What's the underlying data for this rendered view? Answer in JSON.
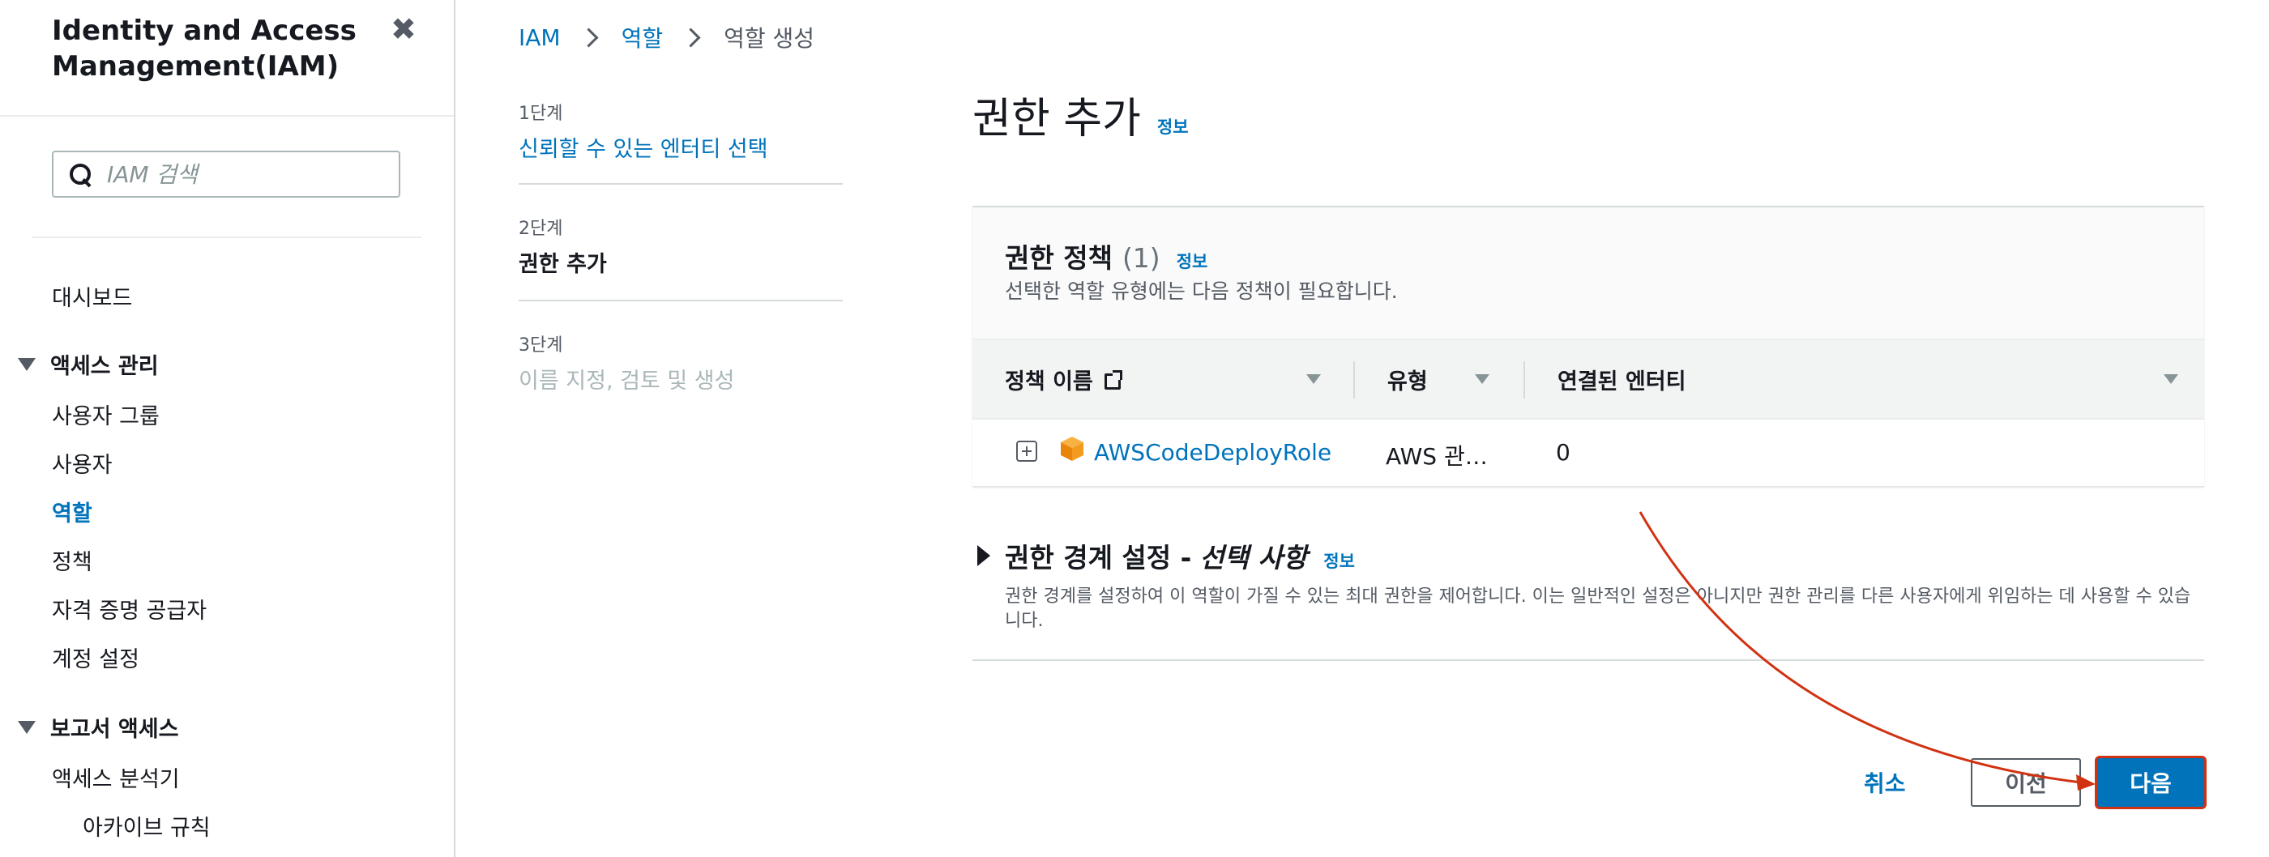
{
  "sidebar": {
    "title": "Identity and Access Management(IAM)",
    "search_placeholder": "IAM 검색",
    "items": {
      "dashboard": "대시보드",
      "access_mgmt": "액세스 관리",
      "user_groups": "사용자 그룹",
      "users": "사용자",
      "roles": "역할",
      "policies": "정책",
      "identity_providers": "자격 증명 공급자",
      "account_settings": "계정 설정",
      "reports_access": "보고서 액세스",
      "access_analyzer": "액세스 분석기",
      "archive_rules": "아카이브 규칙"
    }
  },
  "breadcrumb": {
    "iam": "IAM",
    "roles": "역할",
    "current": "역할 생성"
  },
  "steps": [
    {
      "num": "1단계",
      "label": "신뢰할 수 있는 엔터티 선택"
    },
    {
      "num": "2단계",
      "label": "권한 추가"
    },
    {
      "num": "3단계",
      "label": "이름 지정, 검토 및 생성"
    }
  ],
  "page": {
    "title": "권한 추가",
    "info": "정보"
  },
  "policies_panel": {
    "title": "권한 정책",
    "count": "(1)",
    "info": "정보",
    "description": "선택한 역할 유형에는 다음 정책이 필요합니다.",
    "columns": {
      "name": "정책 이름",
      "type": "유형",
      "entities": "연결된 엔터티"
    },
    "rows": [
      {
        "name": "AWSCodeDeployRole",
        "type": "AWS 관…",
        "entities": "0"
      }
    ]
  },
  "boundary": {
    "title": "권한 경계 설정 -",
    "title_italic": "선택 사항",
    "info": "정보",
    "description": "권한 경계를 설정하여 이 역할이 가질 수 있는 최대 권한을 제어합니다. 이는 일반적인 설정은 아니지만 권한 관리를 다른 사용자에게 위임하는 데 사용할 수 있습니다."
  },
  "actions": {
    "cancel": "취소",
    "previous": "이전",
    "next": "다음"
  },
  "colors": {
    "link": "#0073bb",
    "primary": "#0073bb",
    "annotation": "#d13212"
  }
}
